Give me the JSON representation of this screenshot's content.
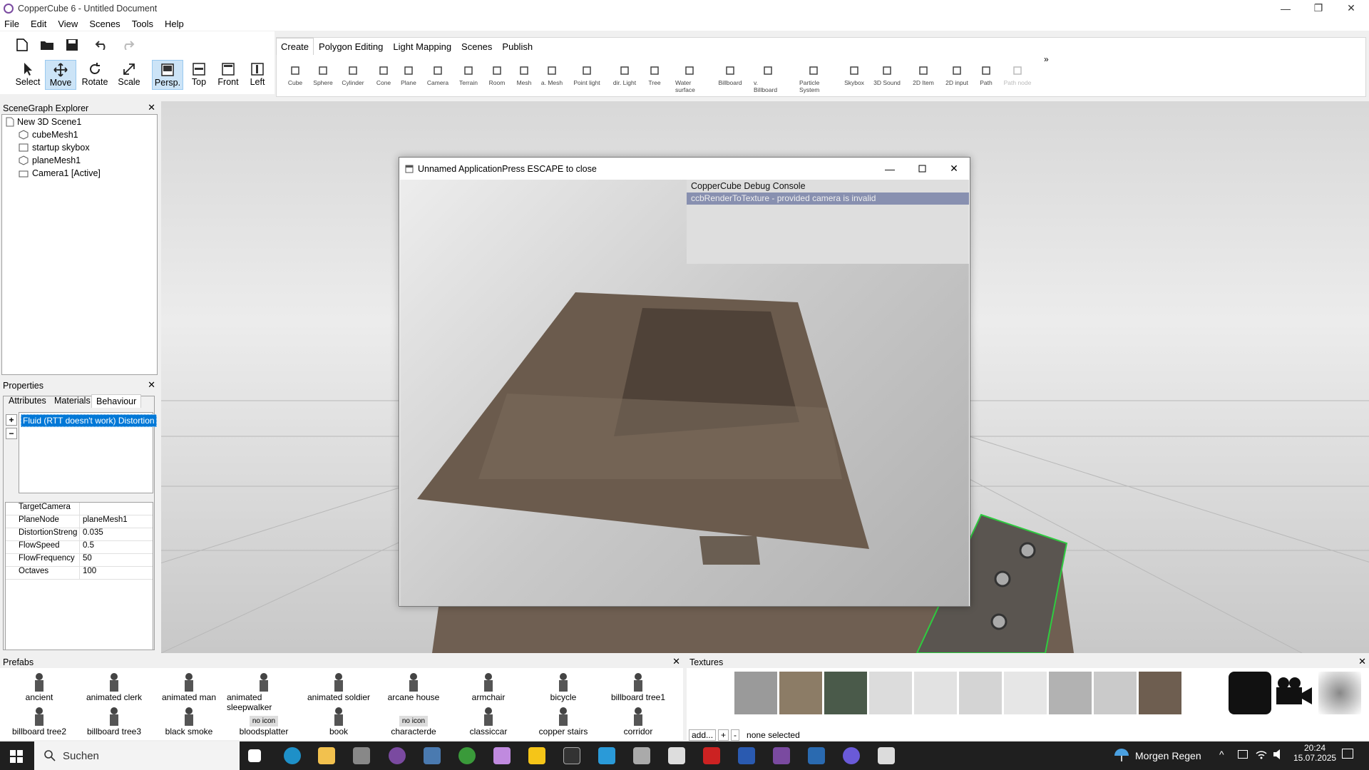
{
  "window": {
    "title": "CopperCube 6 - Untitled Document",
    "min": "—",
    "max": "❐",
    "close": "✕"
  },
  "menu": [
    "File",
    "Edit",
    "View",
    "Scenes",
    "Tools",
    "Help"
  ],
  "nav_buttons": [
    {
      "label": "Select",
      "icon": "arrow-pointer-icon"
    },
    {
      "label": "Move",
      "icon": "move-arrows-icon"
    },
    {
      "label": "Rotate",
      "icon": "rotate-icon"
    },
    {
      "label": "Scale",
      "icon": "scale-icon"
    },
    {
      "label": "Persp.",
      "icon": "perspective-icon"
    },
    {
      "label": "Top",
      "icon": "top-view-icon"
    },
    {
      "label": "Front",
      "icon": "front-view-icon"
    },
    {
      "label": "Left",
      "icon": "left-view-icon"
    }
  ],
  "ribbon_tabs": [
    "Create",
    "Polygon Editing",
    "Light Mapping",
    "Scenes",
    "Publish"
  ],
  "ribbon_items": [
    "Cube",
    "Sphere",
    "Cylinder",
    "Cone",
    "Plane",
    "Camera",
    "Terrain",
    "Room",
    "Mesh",
    "a. Mesh",
    "Point light",
    "dir. Light",
    "Tree",
    "Water surface",
    "Billboard",
    "v. Billboard",
    "Particle System",
    "Skybox",
    "3D Sound",
    "2D Item",
    "2D input",
    "Path",
    "Path node"
  ],
  "ribbon_more": "»",
  "scenegraph": {
    "title": "SceneGraph Explorer",
    "close": "✕",
    "root": "New 3D Scene1",
    "items": [
      "cubeMesh1",
      "startup skybox",
      "planeMesh1",
      "Camera1 [Active]"
    ]
  },
  "properties": {
    "title": "Properties",
    "close": "✕",
    "tabs": [
      "Attributes",
      "Materials",
      "Behaviour"
    ],
    "behaviour": "Fluid (RTT doesn't work) Distortion",
    "add": "+",
    "remove": "−",
    "attrs": [
      {
        "k": "TargetCamera",
        "v": ""
      },
      {
        "k": "PlaneNode",
        "v": "planeMesh1"
      },
      {
        "k": "DistortionStreng",
        "v": "0.035"
      },
      {
        "k": "FlowSpeed",
        "v": "0.5"
      },
      {
        "k": "FlowFrequency",
        "v": "50"
      },
      {
        "k": "Octaves",
        "v": "100"
      }
    ]
  },
  "appwin": {
    "title": "Unnamed ApplicationPress ESCAPE to close",
    "console_title": "CopperCube Debug Console",
    "console_line": "ccbRenderToTexture - provided camera is invalid"
  },
  "prefabs": {
    "title": "Prefabs",
    "close": "✕",
    "row1": [
      "ancient",
      "animated clerk",
      "animated man",
      "animated sleepwalker",
      "animated soldier",
      "arcane house",
      "armchair",
      "bicycle",
      "billboard tree1"
    ],
    "row2": [
      "billboard tree2",
      "billboard tree3",
      "black smoke",
      "bloodsplatter",
      "book",
      "characterde",
      "classiccar",
      "copper stairs",
      "corridor"
    ],
    "noicon": "no icon"
  },
  "textures": {
    "title": "Textures",
    "close": "✕",
    "add": "add...",
    "plus": "+",
    "minus": "-",
    "status": "none selected"
  },
  "taskbar": {
    "search": "Suchen",
    "weather": "Morgen Regen",
    "time": "20:24",
    "date": "15.07.2025"
  }
}
